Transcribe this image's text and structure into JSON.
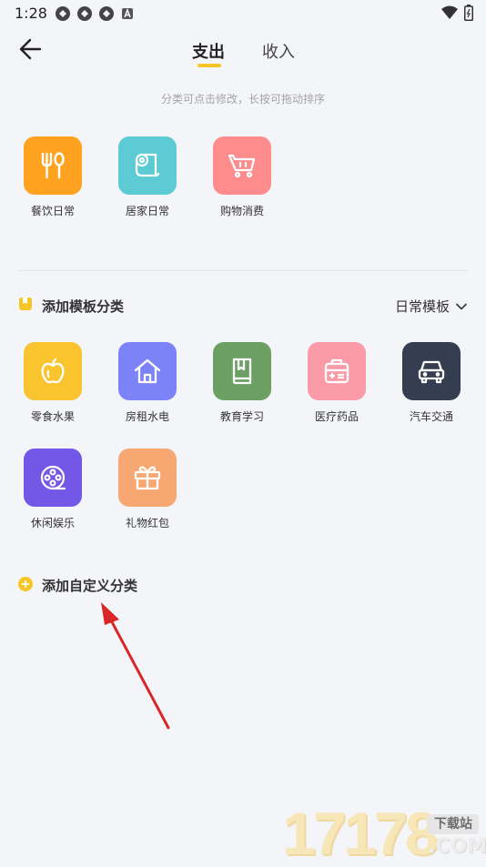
{
  "status_bar": {
    "time": "1:28"
  },
  "nav": {
    "tabs": [
      {
        "label": "支出"
      },
      {
        "label": "收入"
      }
    ]
  },
  "hint": "分类可点击修改，长按可拖动排序",
  "my_categories": [
    {
      "label": "餐饮日常",
      "color": "#ffa21f",
      "icon": "fork-knife-icon"
    },
    {
      "label": "居家日常",
      "color": "#5ccbd3",
      "icon": "tissue-roll-icon"
    },
    {
      "label": "购物消费",
      "color": "#fe8c8c",
      "icon": "shopping-cart-icon"
    }
  ],
  "template_section": {
    "title": "添加模板分类",
    "selector_label": "日常模板",
    "categories": [
      {
        "label": "零食水果",
        "color": "#f9c42d",
        "icon": "apple-icon"
      },
      {
        "label": "房租水电",
        "color": "#7b83f6",
        "icon": "house-icon"
      },
      {
        "label": "教育学习",
        "color": "#6c9f63",
        "icon": "book-icon"
      },
      {
        "label": "医疗药品",
        "color": "#fb9ba8",
        "icon": "medicine-box-icon"
      },
      {
        "label": "汽车交通",
        "color": "#353d50",
        "icon": "car-icon"
      },
      {
        "label": "休闲娱乐",
        "color": "#7357e6",
        "icon": "film-reel-icon"
      },
      {
        "label": "礼物红包",
        "color": "#f7a872",
        "icon": "gift-icon"
      }
    ]
  },
  "custom_section": {
    "title": "添加自定义分类"
  },
  "watermark": {
    "digits": "17178",
    "badge": "下载站",
    "suffix": ".COM"
  },
  "accent_color": "#f7c525"
}
